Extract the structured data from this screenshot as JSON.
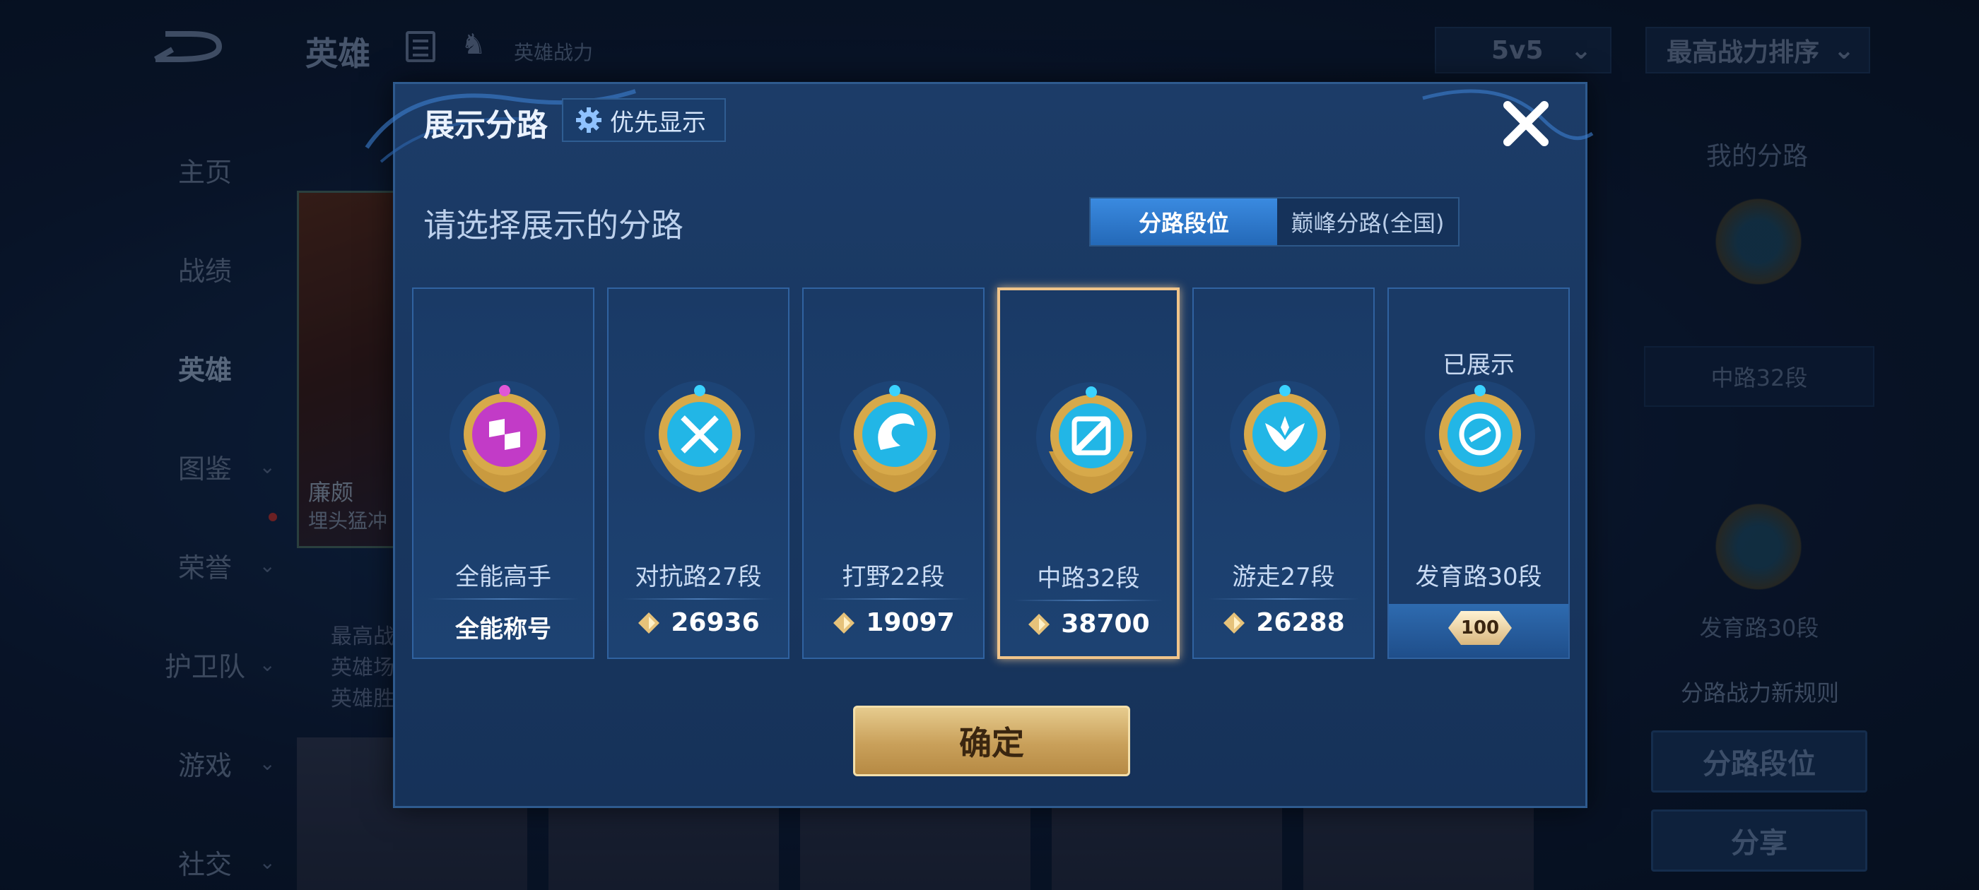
{
  "background": {
    "nav_title": "英雄",
    "power_label": "英雄战力",
    "mode_select": "5v5",
    "sort_select": "最高战力排序",
    "side_nav": [
      {
        "label": "主页",
        "has_chevron": false
      },
      {
        "label": "战绩",
        "has_chevron": false
      },
      {
        "label": "英雄",
        "has_chevron": false,
        "active": true
      },
      {
        "label": "图鉴",
        "has_chevron": true
      },
      {
        "label": "荣誉",
        "has_chevron": true
      },
      {
        "label": "护卫队",
        "has_chevron": true
      },
      {
        "label": "游戏",
        "has_chevron": true
      },
      {
        "label": "社交",
        "has_chevron": true
      }
    ],
    "hero_name": "廉颇",
    "hero_subtitle": "埋头猛冲",
    "hero_stats": [
      "最高战",
      "英雄场",
      "英雄胜"
    ],
    "right_panel": {
      "title": "我的分路",
      "label_1": "中路32段",
      "label_2": "发育路30段",
      "rule_text": "分路战力新规则",
      "btn_lane_rank": "分路段位",
      "btn_share": "分享"
    }
  },
  "modal": {
    "title": "展示分路",
    "priority_button": "优先显示",
    "subtitle": "请选择展示的分路",
    "segment": {
      "options": [
        "分路段位",
        "巅峰分路(全国)"
      ],
      "selected": "分路段位"
    },
    "cards": [
      {
        "name": "全能高手",
        "bottom_text": "全能称号",
        "icon": "all-round-badge-icon",
        "color": "#c23bc7"
      },
      {
        "name": "对抗路27段",
        "score": "26936",
        "icon": "clash-lane-badge-icon",
        "color": "#22b6e6"
      },
      {
        "name": "打野22段",
        "score": "19097",
        "icon": "jungle-badge-icon",
        "color": "#22b6e6"
      },
      {
        "name": "中路32段",
        "score": "38700",
        "icon": "mid-lane-badge-icon",
        "color": "#22b6e6",
        "selected": true
      },
      {
        "name": "游走27段",
        "score": "26288",
        "icon": "roam-badge-icon",
        "color": "#22b6e6"
      },
      {
        "name": "发育路30段",
        "status": "已展示",
        "banner_number": "100",
        "icon": "farm-lane-badge-icon",
        "color": "#22b6e6"
      }
    ],
    "confirm_button": "确定"
  },
  "colors": {
    "accent_blue": "#2a7ad0",
    "gold": "#c9a05a",
    "selected_border": "#f0c48a",
    "modal_bg": "#1c3c68"
  }
}
